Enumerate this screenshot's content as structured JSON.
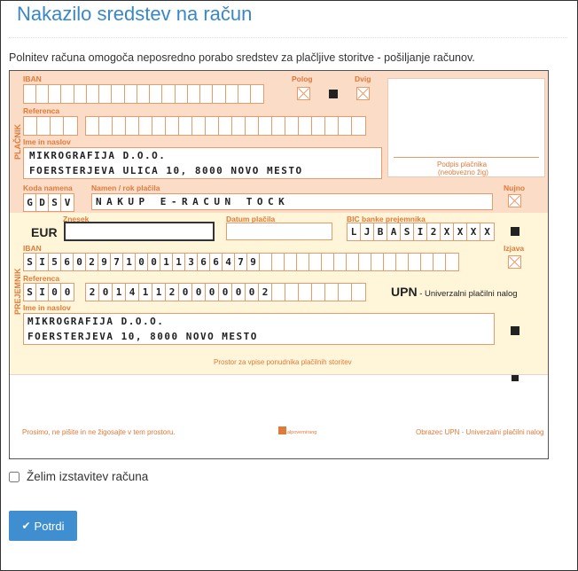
{
  "page": {
    "title": "Nakazilo sredstev na račun",
    "description": "Polnitev računa omogoča neposredno porabo sredstev za plačljive storitve - pošiljanje računov."
  },
  "form": {
    "platnik": {
      "section_label": "PLAČNIK",
      "iban_label": "IBAN",
      "polog_label": "Polog",
      "dvig_label": "Dvig",
      "referenca_label": "Referenca",
      "ime_label": "Ime in naslov",
      "name_line1": "MIKROGRAFIJA D.O.O.",
      "name_line2": "FOERSTERJEVA ULICA 10, 8000 NOVO MESTO",
      "podpis_label": "Podpis plačnika",
      "podpis_sub": "(neobvezno žig)"
    },
    "koda_label": "Koda namena",
    "koda_value": [
      "G",
      "D",
      "S",
      "V"
    ],
    "namen_label": "Namen / rok plačila",
    "namen_value": "NAKUP E-RACUN TOCK",
    "nujno_label": "Nujno",
    "znesek_label": "Znesek",
    "eur_label": "EUR",
    "datum_label": "Datum plačila",
    "bic_label": "BIC banke prejemnika",
    "bic_value": [
      "L",
      "J",
      "B",
      "A",
      "S",
      "I",
      "2",
      "X",
      "X",
      "X",
      "X"
    ],
    "prejemnik": {
      "section_label": "PREJEMNIK",
      "iban_label": "IBAN",
      "izjava_label": "Izjava",
      "iban_value": [
        "S",
        "I",
        "5",
        "6",
        "0",
        "2",
        "9",
        "7",
        "1",
        "0",
        "0",
        "1",
        "1",
        "3",
        "6",
        "6",
        "4",
        "7",
        "9"
      ],
      "referenca_label": "Referenca",
      "ref_model": [
        "S",
        "I",
        "0",
        "0"
      ],
      "ref_value": [
        "2",
        "0",
        "1",
        "4",
        "1",
        "1",
        "2",
        "0",
        "0",
        "0",
        "0",
        "0",
        "0",
        "2"
      ],
      "ime_label": "Ime in naslov",
      "name_line1": "MIKROGRAFIJA D.O.O.",
      "name_line2": "FOERSTERJEVA 10, 8000 NOVO MESTO"
    },
    "upn_title": "UPN",
    "upn_sub": " - Univerzalni plačilni nalog",
    "prostor_label": "Prostor za vpise ponudnika plačilnih storitev",
    "footer_left": "Prosimo, ne pišite in ne žigosajte v tem prostoru.",
    "footer_logo": "alpovernirang",
    "footer_right": "Obrazec UPN - Univerzalni plačilni nalog"
  },
  "invoice_checkbox_label": "Želim izstavitev računa",
  "submit_label": "Potrdi",
  "colors": {
    "accent": "#3f8fd0",
    "form_top": "#fadcc7",
    "form_bottom": "#fff6d9",
    "form_line": "#e07a3a"
  }
}
